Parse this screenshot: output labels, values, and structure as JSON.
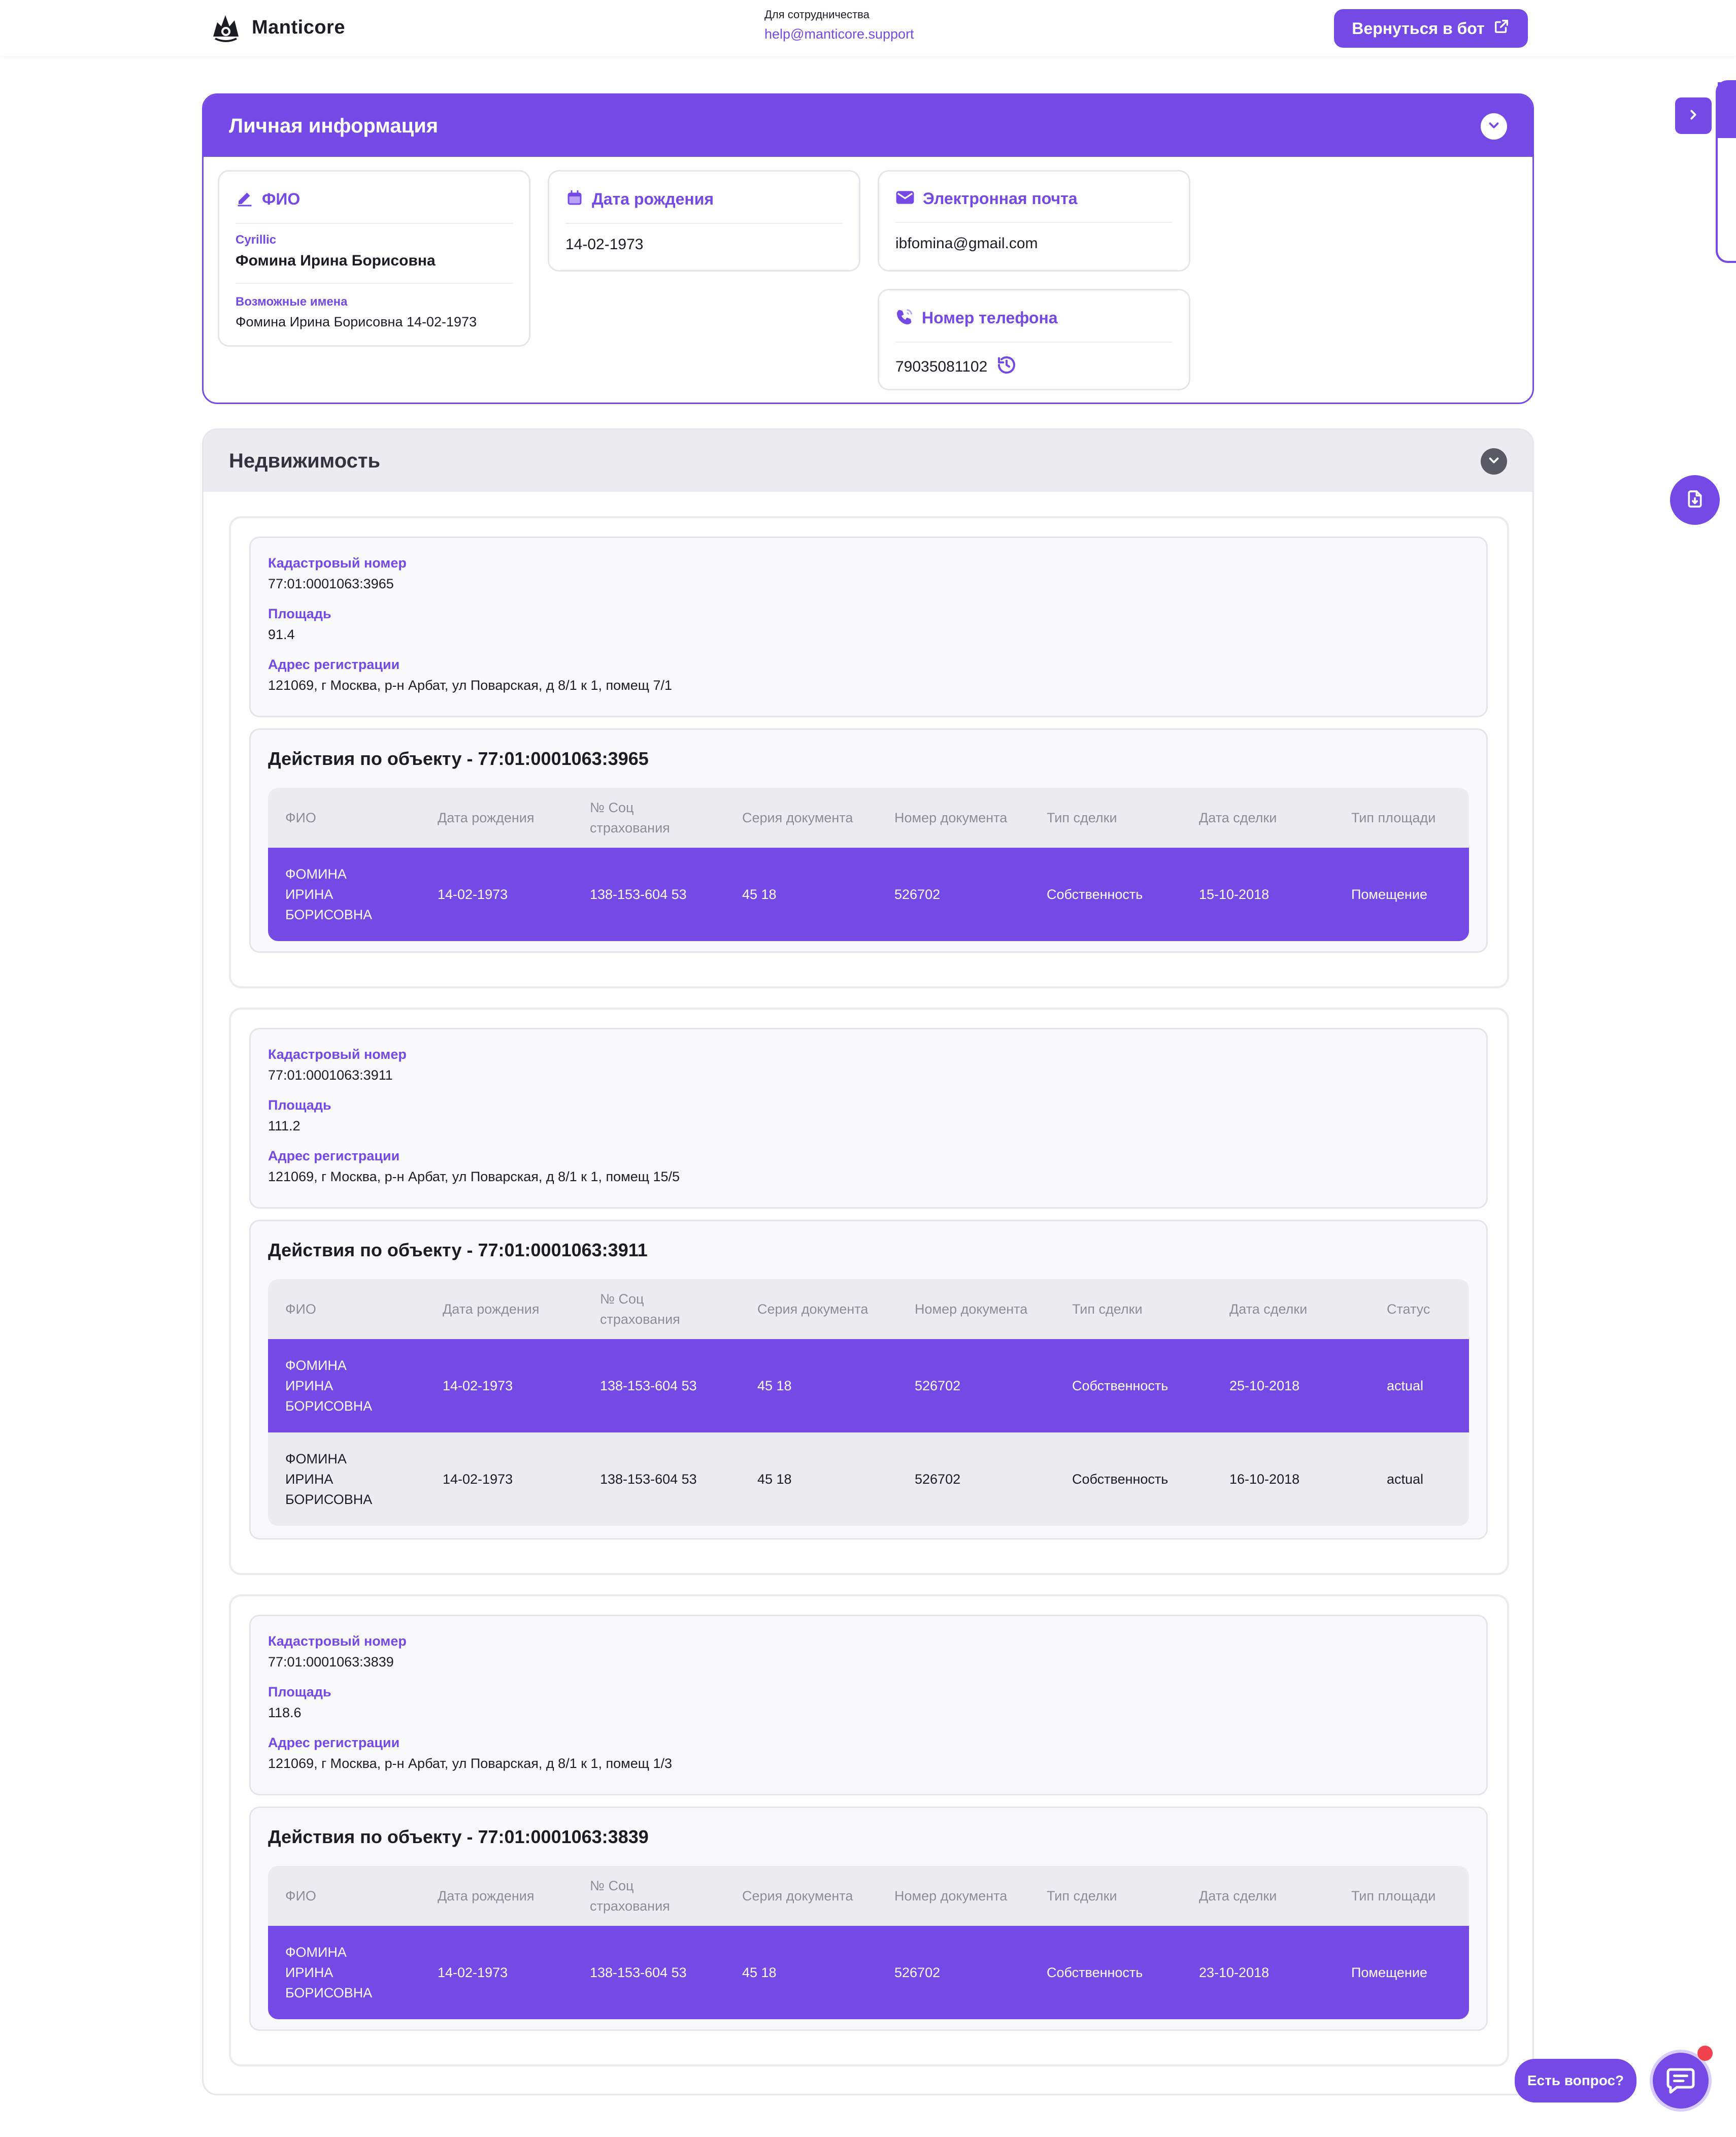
{
  "brand": {
    "name": "Manticore",
    "accent": "#7449e6"
  },
  "header": {
    "coop_label": "Для сотрудничества",
    "coop_email": "help@manticore.support",
    "back_button": "Вернуться в бот"
  },
  "personal": {
    "title": "Личная информация",
    "fio": {
      "label": "ФИО",
      "sub_label": "Cyrillic",
      "value": "Фомина Ирина Борисовна",
      "alt_label": "Возможные имена",
      "alt_value": "Фомина Ирина Борисовна 14-02-1973"
    },
    "birth": {
      "label": "Дата рождения",
      "value": "14-02-1973"
    },
    "email": {
      "label": "Электронная почта",
      "value": "ibfomina@gmail.com"
    },
    "phone": {
      "label": "Номер телефона",
      "value": "79035081102"
    }
  },
  "real_estate": {
    "title": "Недвижимость",
    "labels": {
      "cadastral": "Кадастровый номер",
      "area": "Площадь",
      "address": "Адрес регистрации"
    },
    "properties": [
      {
        "cadastral": "77:01:0001063:3965",
        "area": "91.4",
        "address": "121069, г Москва, р-н Арбат, ул Поварская, д 8/1 к 1, помещ 7/1",
        "actions_title": "Действия по объекту - 77:01:0001063:3965",
        "columns": [
          "ФИО",
          "Дата рождения",
          "№ Соц страхования",
          "Серия документа",
          "Номер документа",
          "Тип сделки",
          "Дата сделки",
          "Тип площади"
        ],
        "rows": [
          [
            "ФОМИНА ИРИНА БОРИСОВНА",
            "14-02-1973",
            "138-153-604 53",
            "45 18",
            "526702",
            "Собственность",
            "15-10-2018",
            "Помещение"
          ]
        ]
      },
      {
        "cadastral": "77:01:0001063:3911",
        "area": "111.2",
        "address": "121069, г Москва, р-н Арбат, ул Поварская, д 8/1 к 1, помещ 15/5",
        "actions_title": "Действия по объекту - 77:01:0001063:3911",
        "columns": [
          "ФИО",
          "Дата рождения",
          "№ Соц страхования",
          "Серия документа",
          "Номер документа",
          "Тип сделки",
          "Дата сделки",
          "Статус"
        ],
        "rows": [
          [
            "ФОМИНА ИРИНА БОРИСОВНА",
            "14-02-1973",
            "138-153-604 53",
            "45 18",
            "526702",
            "Собственность",
            "25-10-2018",
            "actual"
          ],
          [
            "ФОМИНА ИРИНА БОРИСОВНА",
            "14-02-1973",
            "138-153-604 53",
            "45 18",
            "526702",
            "Собственность",
            "16-10-2018",
            "actual"
          ]
        ]
      },
      {
        "cadastral": "77:01:0001063:3839",
        "area": "118.6",
        "address": "121069, г Москва, р-н Арбат, ул Поварская, д 8/1 к 1, помещ 1/3",
        "actions_title": "Действия по объекту - 77:01:0001063:3839",
        "columns": [
          "ФИО",
          "Дата рождения",
          "№ Соц страхования",
          "Серия документа",
          "Номер документа",
          "Тип сделки",
          "Дата сделки",
          "Тип площади"
        ],
        "rows": [
          [
            "ФОМИНА ИРИНА БОРИСОВНА",
            "14-02-1973",
            "138-153-604 53",
            "45 18",
            "526702",
            "Собственность",
            "23-10-2018",
            "Помещение"
          ]
        ]
      }
    ]
  },
  "support": {
    "ask_label": "Есть вопрос?"
  },
  "icons": {
    "fio": "pencil-icon",
    "birth": "calendar-icon",
    "email": "envelope-icon",
    "phone": "phone-icon",
    "history": "history-icon",
    "back": "external-link-icon",
    "download": "file-download-icon",
    "chat": "chat-icon"
  }
}
